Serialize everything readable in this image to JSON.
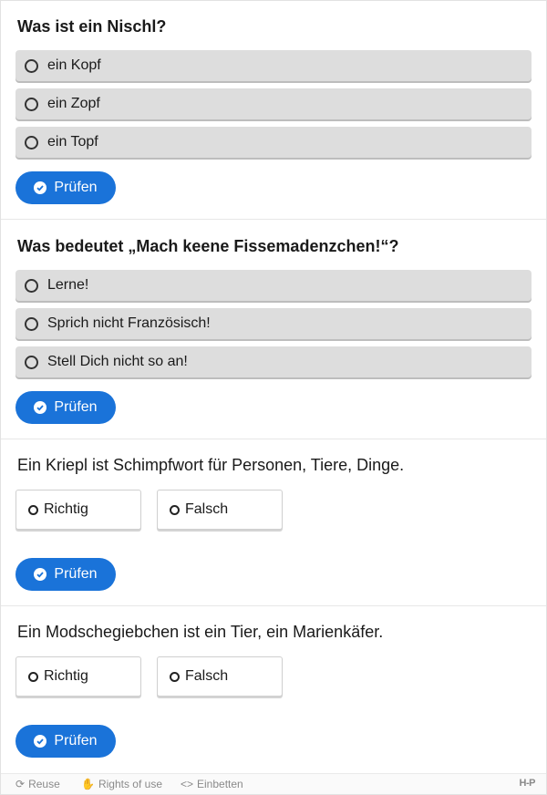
{
  "questions": [
    {
      "title": "Was ist ein Nischl?",
      "options": [
        "ein Kopf",
        "ein Zopf",
        "ein Topf"
      ],
      "check_label": "Prüfen"
    },
    {
      "title": "Was bedeutet „Mach keene Fissemadenzchen!“?",
      "options": [
        "Lerne!",
        "Sprich nicht Französisch!",
        "Stell Dich nicht so an!"
      ],
      "check_label": "Prüfen"
    }
  ],
  "truefalse": [
    {
      "statement": "Ein Kriepl ist Schimpfwort für Personen, Tiere, Dinge.",
      "true_label": "Richtig",
      "false_label": "Falsch",
      "check_label": "Prüfen"
    },
    {
      "statement": "Ein Modschegiebchen ist ein Tier, ein Marienkäfer.",
      "true_label": "Richtig",
      "false_label": "Falsch",
      "check_label": "Prüfen"
    }
  ],
  "footer": {
    "reuse_label": "Reuse",
    "rights_label": "Rights of use",
    "embed_label": "Einbetten",
    "brand": "H-P",
    "reuse_icon": "refresh-icon",
    "rights_icon": "handshake-icon",
    "embed_icon": "code-icon"
  },
  "colors": {
    "accent": "#1a73d9",
    "option_bg": "#dddddd"
  }
}
